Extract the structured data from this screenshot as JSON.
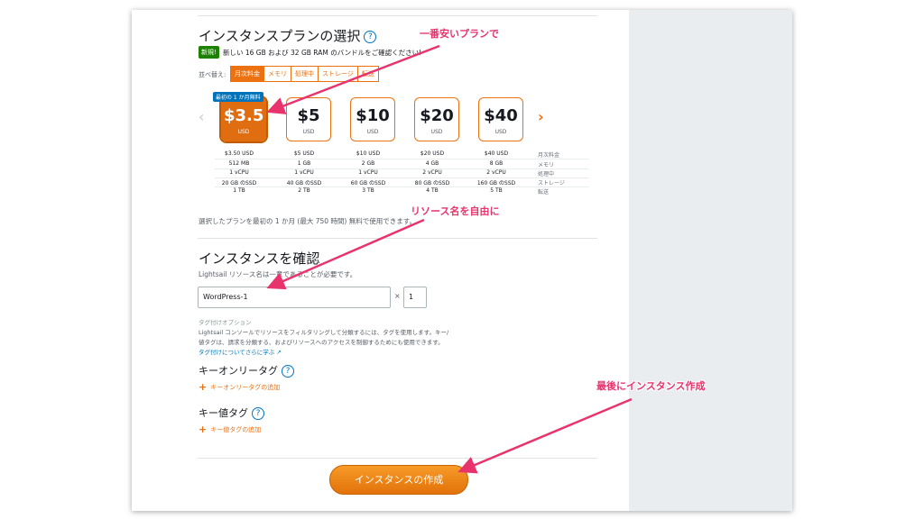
{
  "plan_section": {
    "title": "インスタンスプランの選択",
    "new_badge": "新規!",
    "new_text": "新しい 16 GB および 32 GB RAM のバンドルをご確認ください!"
  },
  "sort": {
    "label": "並べ替え:",
    "tabs": [
      "月次料金",
      "メモリ",
      "処理中",
      "ストレージ",
      "転送"
    ]
  },
  "free_badge": "最初の 1 か月無料",
  "plans": [
    {
      "price": "$3.5",
      "currency": "USD",
      "monthly": "$3.50 USD",
      "memory": "512 MB",
      "cpu": "1 vCPU",
      "storage": "20 GB のSSD",
      "transfer": "1 TB"
    },
    {
      "price": "$5",
      "currency": "USD",
      "monthly": "$5 USD",
      "memory": "1 GB",
      "cpu": "1 vCPU",
      "storage": "40 GB のSSD",
      "transfer": "2 TB"
    },
    {
      "price": "$10",
      "currency": "USD",
      "monthly": "$10 USD",
      "memory": "2 GB",
      "cpu": "1 vCPU",
      "storage": "60 GB のSSD",
      "transfer": "3 TB"
    },
    {
      "price": "$20",
      "currency": "USD",
      "monthly": "$20 USD",
      "memory": "4 GB",
      "cpu": "2 vCPU",
      "storage": "80 GB のSSD",
      "transfer": "4 TB"
    },
    {
      "price": "$40",
      "currency": "USD",
      "monthly": "$40 USD",
      "memory": "8 GB",
      "cpu": "2 vCPU",
      "storage": "160 GB のSSD",
      "transfer": "5 TB"
    }
  ],
  "spec_names": [
    "月次料金",
    "メモリ",
    "処理中",
    "ストレージ",
    "転送"
  ],
  "plan_note": "選択したプランを最初の 1 か月 (最大 750 時間) 無料で使用できます。",
  "confirm": {
    "title": "インスタンスを確認",
    "note": "Lightsail リソース名は一意であることが必要です。",
    "name_value": "WordPress-1",
    "times": "×",
    "count_value": "1"
  },
  "tags": {
    "heading": "タグ付けオプション",
    "desc_line1": "Lightsail コンソールでリソースをフィルタリングして分類するには、タグを使用します。キー/",
    "desc_line2": "値タグは、請求を分類する、およびリソースへのアクセスを制御するためにも使用できます。",
    "learn_more": "タグ付けについてさらに学ぶ",
    "key_only_title": "キーオンリータグ",
    "key_only_add": "キーオンリータグの追加",
    "key_value_title": "キー値タグ",
    "key_value_add": "キー値タグの追加"
  },
  "create_button": "インスタンスの作成",
  "annotations": {
    "cheapest": "一番安いプランで",
    "resource_name": "リソース名を自由に",
    "create_last": "最後にインスタンス作成"
  },
  "colors": {
    "accent": "#ec7211",
    "link": "#0073bb",
    "annotation": "#e8336d",
    "new_badge": "#1d8102"
  }
}
